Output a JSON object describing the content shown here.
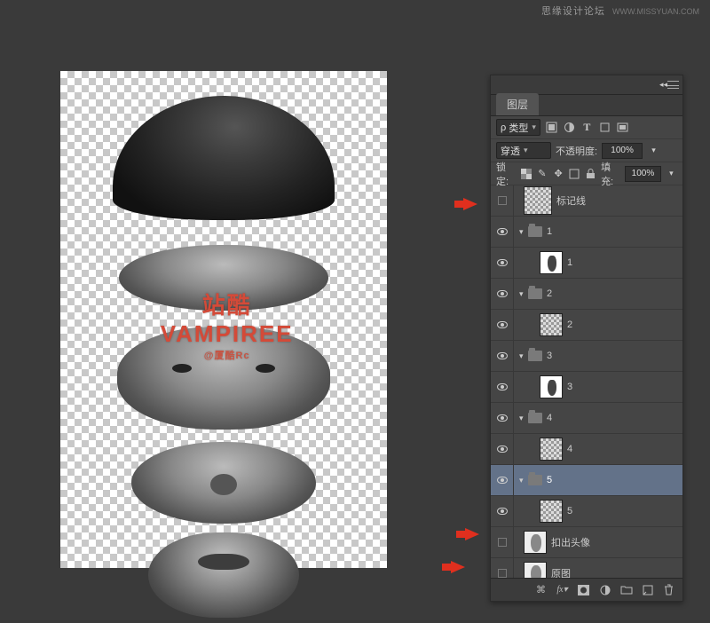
{
  "top_watermark": {
    "main": "思缘设计论坛",
    "sub": "WWW.MISSYUAN.COM"
  },
  "center_watermark": {
    "line1": "站酷 VAMPIREE",
    "line2": "@厦酷Rc"
  },
  "panel": {
    "title": "图层",
    "filter": {
      "kind_label": "类型",
      "kind_prefix": "ρ"
    },
    "blend": {
      "mode": "穿透",
      "opacity_label": "不透明度:",
      "opacity_value": "100%"
    },
    "lock": {
      "label": "锁定:",
      "fill_label": "填充:",
      "fill_value": "100%"
    },
    "layers": [
      {
        "type": "layer",
        "name": "标记线",
        "visible": false,
        "thumb": "transp",
        "indent": 0,
        "big": true
      },
      {
        "type": "group",
        "name": "1",
        "visible": true,
        "open": true,
        "indent": 0
      },
      {
        "type": "layer",
        "name": "1",
        "visible": true,
        "thumb": "dark",
        "indent": 1
      },
      {
        "type": "group",
        "name": "2",
        "visible": true,
        "open": true,
        "indent": 0
      },
      {
        "type": "layer",
        "name": "2",
        "visible": true,
        "thumb": "transp",
        "indent": 1
      },
      {
        "type": "group",
        "name": "3",
        "visible": true,
        "open": true,
        "indent": 0
      },
      {
        "type": "layer",
        "name": "3",
        "visible": true,
        "thumb": "dark",
        "indent": 1
      },
      {
        "type": "group",
        "name": "4",
        "visible": true,
        "open": true,
        "indent": 0
      },
      {
        "type": "layer",
        "name": "4",
        "visible": true,
        "thumb": "transp",
        "indent": 1
      },
      {
        "type": "group",
        "name": "5",
        "visible": true,
        "open": true,
        "indent": 0,
        "selected": true
      },
      {
        "type": "layer",
        "name": "5",
        "visible": true,
        "thumb": "transp",
        "indent": 1
      },
      {
        "type": "layer",
        "name": "扣出头像",
        "visible": false,
        "thumb": "face",
        "indent": 0
      },
      {
        "type": "layer",
        "name": "原图",
        "visible": false,
        "thumb": "face",
        "indent": 0
      }
    ],
    "footer_icons": [
      "link-icon",
      "fx-icon",
      "mask-icon",
      "adjust-icon",
      "group-icon",
      "new-layer-icon",
      "trash-icon"
    ]
  }
}
